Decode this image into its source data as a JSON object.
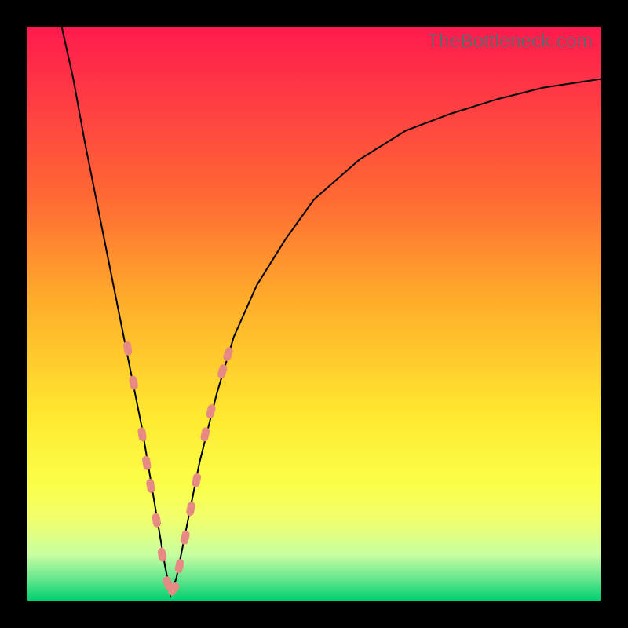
{
  "watermark": "TheBottleneck.com",
  "colors": {
    "frame": "#000000",
    "curve": "#000000",
    "marker": "#e88a84",
    "gradient_stops": [
      "#ff1a4d",
      "#ff3a44",
      "#ff6a33",
      "#ffae2b",
      "#ffe92f",
      "#fbff4a",
      "#f0ff6e",
      "#c8ffa0",
      "#6be88f",
      "#00d070"
    ]
  },
  "chart_data": {
    "type": "line",
    "title": "",
    "xlabel": "",
    "ylabel": "",
    "xlim": [
      0,
      100
    ],
    "ylim": [
      0,
      100
    ],
    "curve": {
      "description": "Single V-shaped bottleneck curve with minimum near x≈25",
      "x": [
        6,
        8,
        10,
        12,
        14,
        16,
        18,
        20,
        22,
        24,
        25,
        26,
        28,
        30,
        33,
        36,
        40,
        45,
        50,
        58,
        66,
        74,
        82,
        90,
        100
      ],
      "y": [
        100,
        91,
        80,
        70,
        60,
        50,
        40,
        30,
        18,
        6,
        1,
        4,
        14,
        24,
        36,
        46,
        55,
        63,
        70,
        77,
        82,
        85,
        87.5,
        89.5,
        91
      ]
    },
    "markers": {
      "description": "Salmon-colored highlighted sample points / segments along lower portion of curve",
      "points": [
        {
          "x": 17.5,
          "y": 44
        },
        {
          "x": 18.5,
          "y": 38
        },
        {
          "x": 20.0,
          "y": 29
        },
        {
          "x": 20.8,
          "y": 24
        },
        {
          "x": 21.5,
          "y": 20
        },
        {
          "x": 22.5,
          "y": 14
        },
        {
          "x": 23.5,
          "y": 8
        },
        {
          "x": 24.5,
          "y": 3
        },
        {
          "x": 25.5,
          "y": 2
        },
        {
          "x": 26.5,
          "y": 6
        },
        {
          "x": 27.5,
          "y": 11
        },
        {
          "x": 28.5,
          "y": 16
        },
        {
          "x": 29.5,
          "y": 21
        },
        {
          "x": 31.0,
          "y": 29
        },
        {
          "x": 32.0,
          "y": 33
        },
        {
          "x": 34.0,
          "y": 40
        },
        {
          "x": 35.0,
          "y": 43
        }
      ]
    }
  }
}
